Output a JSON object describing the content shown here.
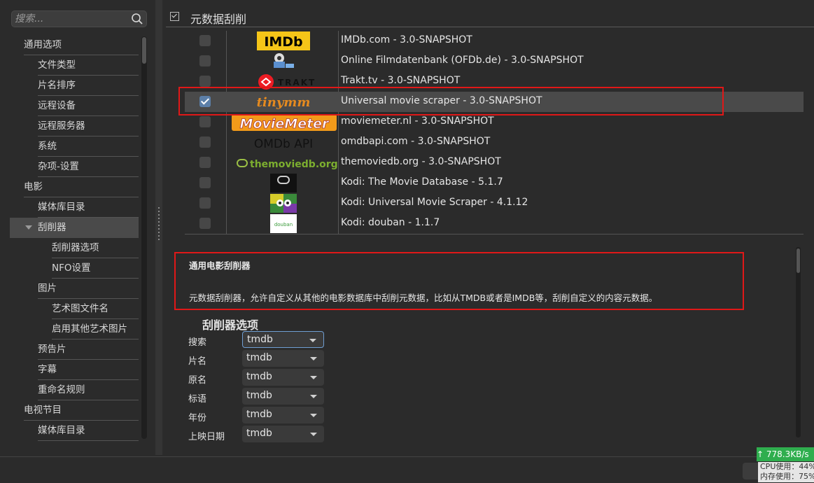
{
  "sidebar": {
    "search_placeholder": "搜索...",
    "tree": [
      {
        "label": "通用选项"
      },
      {
        "label": "文件类型"
      },
      {
        "label": "片名排序"
      },
      {
        "label": "远程设备"
      },
      {
        "label": "远程服务器"
      },
      {
        "label": "系统"
      },
      {
        "label": "杂项-设置"
      },
      {
        "label": "电影"
      },
      {
        "label": "媒体库目录"
      },
      {
        "label": "刮削器"
      },
      {
        "label": "刮削器选项"
      },
      {
        "label": "NFO设置"
      },
      {
        "label": "图片"
      },
      {
        "label": "艺术图文件名"
      },
      {
        "label": "启用其他艺术图片"
      },
      {
        "label": "预告片"
      },
      {
        "label": "字幕"
      },
      {
        "label": "重命名规则"
      },
      {
        "label": "电视节目"
      },
      {
        "label": "媒体库目录"
      }
    ]
  },
  "section": {
    "title": "元数据刮削"
  },
  "scrapers": [
    {
      "name": "IMDb.com - 3.0-SNAPSHOT",
      "logo": "IMDb",
      "checked": false
    },
    {
      "name": "Online Filmdatenbank (OFDb.de) - 3.0-SNAPSHOT",
      "logo": "ofdb-icon",
      "checked": false
    },
    {
      "name": "Trakt.tv - 3.0-SNAPSHOT",
      "logo": "TRAKT",
      "checked": false
    },
    {
      "name": "Universal movie scraper - 3.0-SNAPSHOT",
      "logo": "tinymm",
      "checked": true
    },
    {
      "name": "moviemeter.nl - 3.0-SNAPSHOT",
      "logo": "MovieMeter",
      "checked": false
    },
    {
      "name": "omdbapi.com - 3.0-SNAPSHOT",
      "logo": "OMDb API",
      "checked": false
    },
    {
      "name": "themoviedb.org - 3.0-SNAPSHOT",
      "logo": "themoviedb.org",
      "checked": false
    },
    {
      "name": "Kodi: The Movie Database - 5.1.7",
      "logo": "kodi-tmdb-icon",
      "checked": false
    },
    {
      "name": "Kodi: Universal Movie Scraper - 4.1.12",
      "logo": "kodi-ums-icon",
      "checked": false
    },
    {
      "name": "Kodi: douban - 1.1.7",
      "logo": "douban",
      "checked": false
    }
  ],
  "description": {
    "title": "通用电影刮削器",
    "text": "元数据刮削器，允许自定义从其他的电影数据库中刮削元数据，比如从TMDB或者是IMDB等，刮削自定义的内容元数据。"
  },
  "options": {
    "title": "刮削器选项",
    "rows": [
      {
        "label": "搜索",
        "value": "tmdb"
      },
      {
        "label": "片名",
        "value": "tmdb"
      },
      {
        "label": "原名",
        "value": "tmdb"
      },
      {
        "label": "标语",
        "value": "tmdb"
      },
      {
        "label": "年份",
        "value": "tmdb"
      },
      {
        "label": "上映日期",
        "value": "tmdb"
      }
    ]
  },
  "status": {
    "net_speed": "↑ 778.3KB/s",
    "cpu": "CPU使用：44%",
    "mem": "内存使用：75%"
  },
  "colors": {
    "highlight_border": "#e01818",
    "accent_green": "#2fae4e"
  }
}
